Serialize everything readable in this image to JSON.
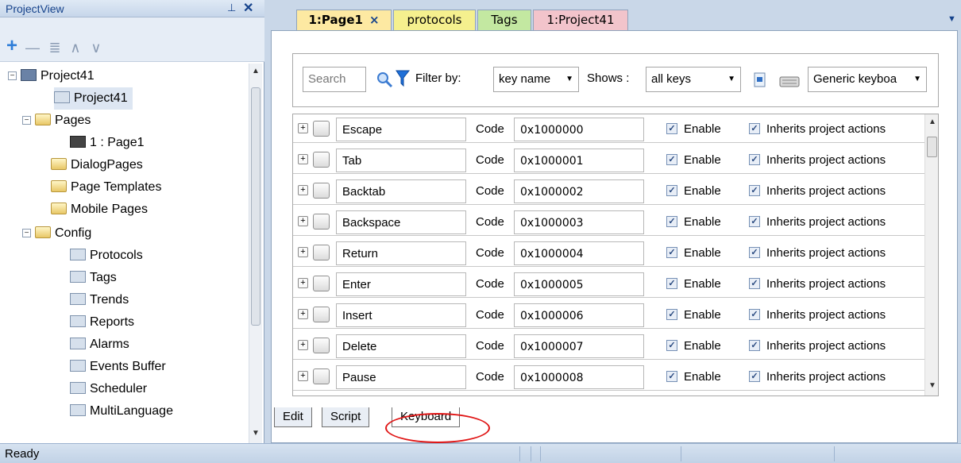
{
  "project_view": {
    "title": "ProjectView",
    "pin_glyph": "⊥",
    "close_glyph": "✕",
    "toolbar": {
      "add": "+",
      "remove": "—",
      "props": "≣",
      "up": "∧",
      "down": "∨"
    },
    "tree": [
      {
        "label": "Project41",
        "icon": "project-icon"
      },
      {
        "label": "Project41",
        "icon": "project-settings-icon"
      },
      {
        "label": "Pages",
        "icon": "folder-icon"
      },
      {
        "label": "1 : Page1",
        "icon": "page-icon"
      },
      {
        "label": "DialogPages",
        "icon": "folder-icon"
      },
      {
        "label": "Page Templates",
        "icon": "folder-icon"
      },
      {
        "label": "Mobile Pages",
        "icon": "folder-icon"
      },
      {
        "label": "Config",
        "icon": "folder-icon"
      },
      {
        "label": "Protocols",
        "icon": "protocols-icon"
      },
      {
        "label": "Tags",
        "icon": "tags-icon"
      },
      {
        "label": "Trends",
        "icon": "trends-icon"
      },
      {
        "label": "Reports",
        "icon": "printer-icon"
      },
      {
        "label": "Alarms",
        "icon": "alarm-bell-icon"
      },
      {
        "label": "Events Buffer",
        "icon": "pushpin-icon"
      },
      {
        "label": "Scheduler",
        "icon": "calendar-icon"
      },
      {
        "label": "MultiLanguage",
        "icon": "chat-bubble-icon"
      }
    ]
  },
  "tabs": [
    {
      "label": "1:Page1",
      "close": "×",
      "color": "#fde9a2"
    },
    {
      "label": "protocols",
      "color": "#f5f08e"
    },
    {
      "label": "Tags",
      "color": "#c3e8a1"
    },
    {
      "label": "1:Project41",
      "color": "#f2c4cb"
    }
  ],
  "filter": {
    "search_placeholder": "Search",
    "filter_by_label": "Filter by:",
    "filter_by_value": "key name",
    "shows_label": "Shows :",
    "shows_value": "all keys",
    "keyboard_value": "Generic keyboa"
  },
  "keys": {
    "code_label": "Code",
    "enable_label": "Enable",
    "inherit_label": "Inherits project actions",
    "rows": [
      {
        "name": "Escape",
        "code": "0x1000000"
      },
      {
        "name": "Tab",
        "code": "0x1000001"
      },
      {
        "name": "Backtab",
        "code": "0x1000002"
      },
      {
        "name": "Backspace",
        "code": "0x1000003"
      },
      {
        "name": "Return",
        "code": "0x1000004"
      },
      {
        "name": "Enter",
        "code": "0x1000005"
      },
      {
        "name": "Insert",
        "code": "0x1000006"
      },
      {
        "name": "Delete",
        "code": "0x1000007"
      },
      {
        "name": "Pause",
        "code": "0x1000008"
      }
    ]
  },
  "bottom_tabs": [
    "Edit",
    "Script",
    "Keyboard"
  ],
  "status": {
    "text": "Ready"
  },
  "colors": {
    "accent": "#15428b",
    "highlight": "#e01515"
  }
}
